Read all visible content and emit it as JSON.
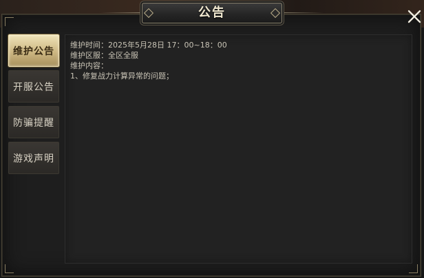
{
  "title": "公告",
  "close_icon": "close-x-icon",
  "tabs": [
    {
      "label": "维护公告",
      "active": true
    },
    {
      "label": "开服公告",
      "active": false
    },
    {
      "label": "防骗提醒",
      "active": false
    },
    {
      "label": "游戏声明",
      "active": false
    }
  ],
  "content": {
    "lines": [
      "维护时间：2025年5月28日 17：00~18：00",
      "维护区服：全区全服",
      "维护内容：",
      "1、修复战力计算异常的问题；"
    ]
  },
  "colors": {
    "active_tab": "#cdb782",
    "title_text": "#f0e8d0",
    "body_text": "#c9c4b6",
    "panel_bg": "#222222"
  }
}
